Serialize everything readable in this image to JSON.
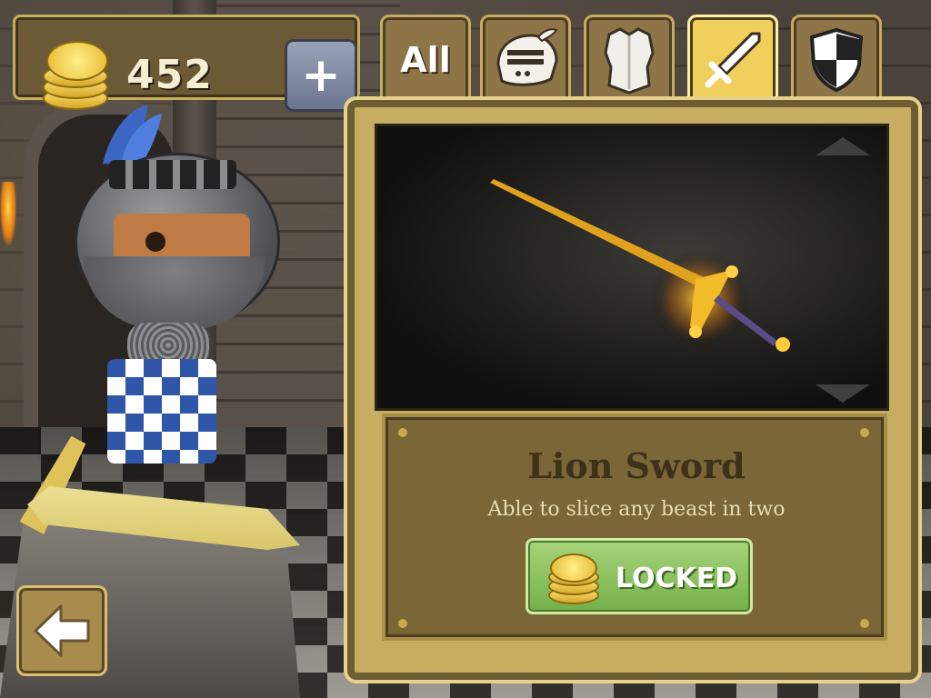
{
  "hud": {
    "coin_count": "452",
    "add_coins_label": "+"
  },
  "tabs": [
    {
      "label": "All",
      "icon": "all-text",
      "active": false
    },
    {
      "label": "",
      "icon": "helmet-icon",
      "active": false
    },
    {
      "label": "",
      "icon": "armor-icon",
      "active": false
    },
    {
      "label": "",
      "icon": "sword-icon",
      "active": true
    },
    {
      "label": "",
      "icon": "shield-icon",
      "active": false
    }
  ],
  "item": {
    "name": "Lion Sword",
    "description": "Able to slice any beast in two",
    "status_label": "LOCKED"
  },
  "colors": {
    "panel": "#c7ad62",
    "active_tab": "#f0cf5c",
    "locked_button": "#8bc35e",
    "coin_gold": "#f2c53a"
  }
}
